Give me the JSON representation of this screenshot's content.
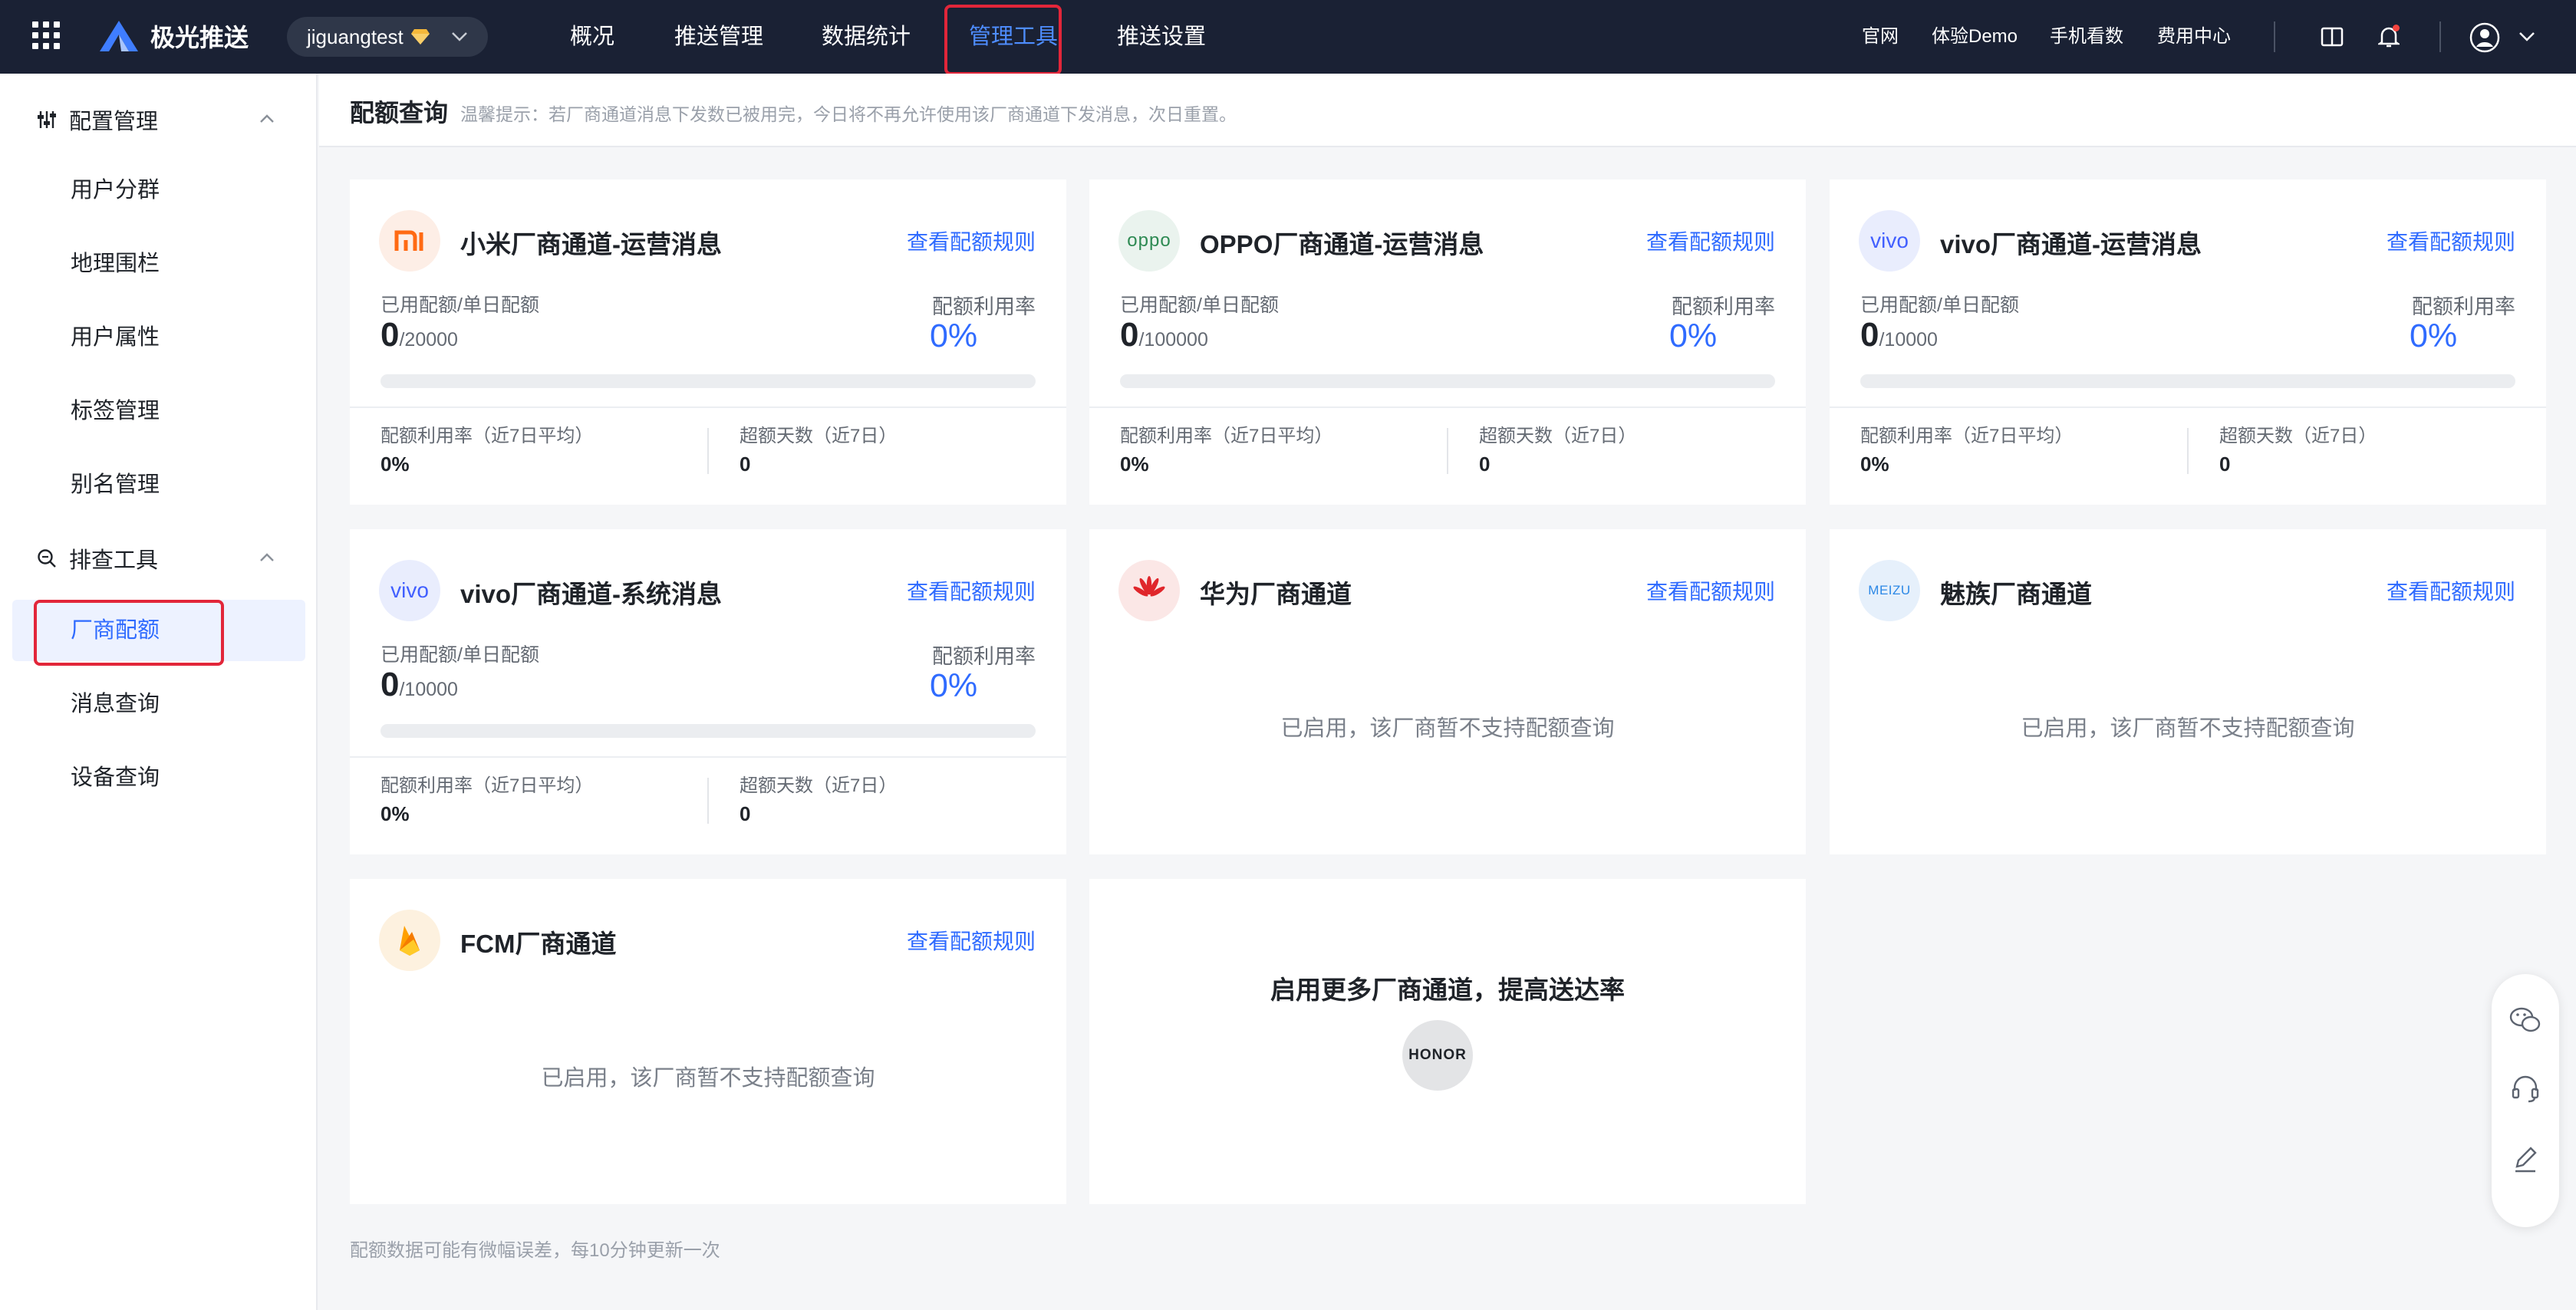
{
  "topbar": {
    "brand": "极光推送",
    "app_name": "jiguangtest",
    "nav": [
      "概况",
      "推送管理",
      "数据统计",
      "管理工具",
      "推送设置"
    ],
    "active_nav": "管理工具",
    "links": [
      "官网",
      "体验Demo",
      "手机看数",
      "费用中心"
    ],
    "accent": "#4e8dff",
    "highlight_color": "#e2263a"
  },
  "sidebar": {
    "groups": [
      {
        "label": "配置管理",
        "icon": "sliders-icon",
        "items": [
          "用户分群",
          "地理围栏",
          "用户属性",
          "标签管理",
          "别名管理"
        ]
      },
      {
        "label": "排查工具",
        "icon": "search-icon",
        "items": [
          "厂商配额",
          "消息查询",
          "设备查询"
        ]
      }
    ],
    "active_item": "厂商配额"
  },
  "page": {
    "title": "配额查询",
    "tip": "温馨提示：若厂商通道消息下发数已被用完，今日将不再允许使用该厂商通道下发消息，次日重置。",
    "footnote": "配额数据可能有微幅误差，每10分钟更新一次"
  },
  "common": {
    "rule_link": "查看配额规则",
    "used_label": "已用配额/单日配额",
    "rate_label": "配额利用率",
    "avg_label": "配额利用率（近7日平均）",
    "over_label": "超额天数（近7日）",
    "unsupported": "已启用，该厂商暂不支持配额查询"
  },
  "cards": [
    {
      "title": "小米厂商通道-运营消息",
      "logo": "MI",
      "used": "0",
      "quota": "/20000",
      "rate": "0%",
      "avg": "0%",
      "over": "0",
      "progress": 0
    },
    {
      "title": "OPPO厂商通道-运营消息",
      "logo": "oppo",
      "used": "0",
      "quota": "/100000",
      "rate": "0%",
      "avg": "0%",
      "over": "0",
      "progress": 0
    },
    {
      "title": "vivo厂商通道-运营消息",
      "logo": "vivo",
      "used": "0",
      "quota": "/10000",
      "rate": "0%",
      "avg": "0%",
      "over": "0",
      "progress": 0
    },
    {
      "title": "vivo厂商通道-系统消息",
      "logo": "vivo",
      "used": "0",
      "quota": "/10000",
      "rate": "0%",
      "avg": "0%",
      "over": "0",
      "progress": 0
    },
    {
      "title": "华为厂商通道",
      "logo": "huawei"
    },
    {
      "title": "魅族厂商通道",
      "logo": "MEIZU"
    },
    {
      "title": "FCM厂商通道",
      "logo": "firebase"
    }
  ],
  "promo": {
    "title": "启用更多厂商通道，提高送达率",
    "honor": "HONOR"
  }
}
